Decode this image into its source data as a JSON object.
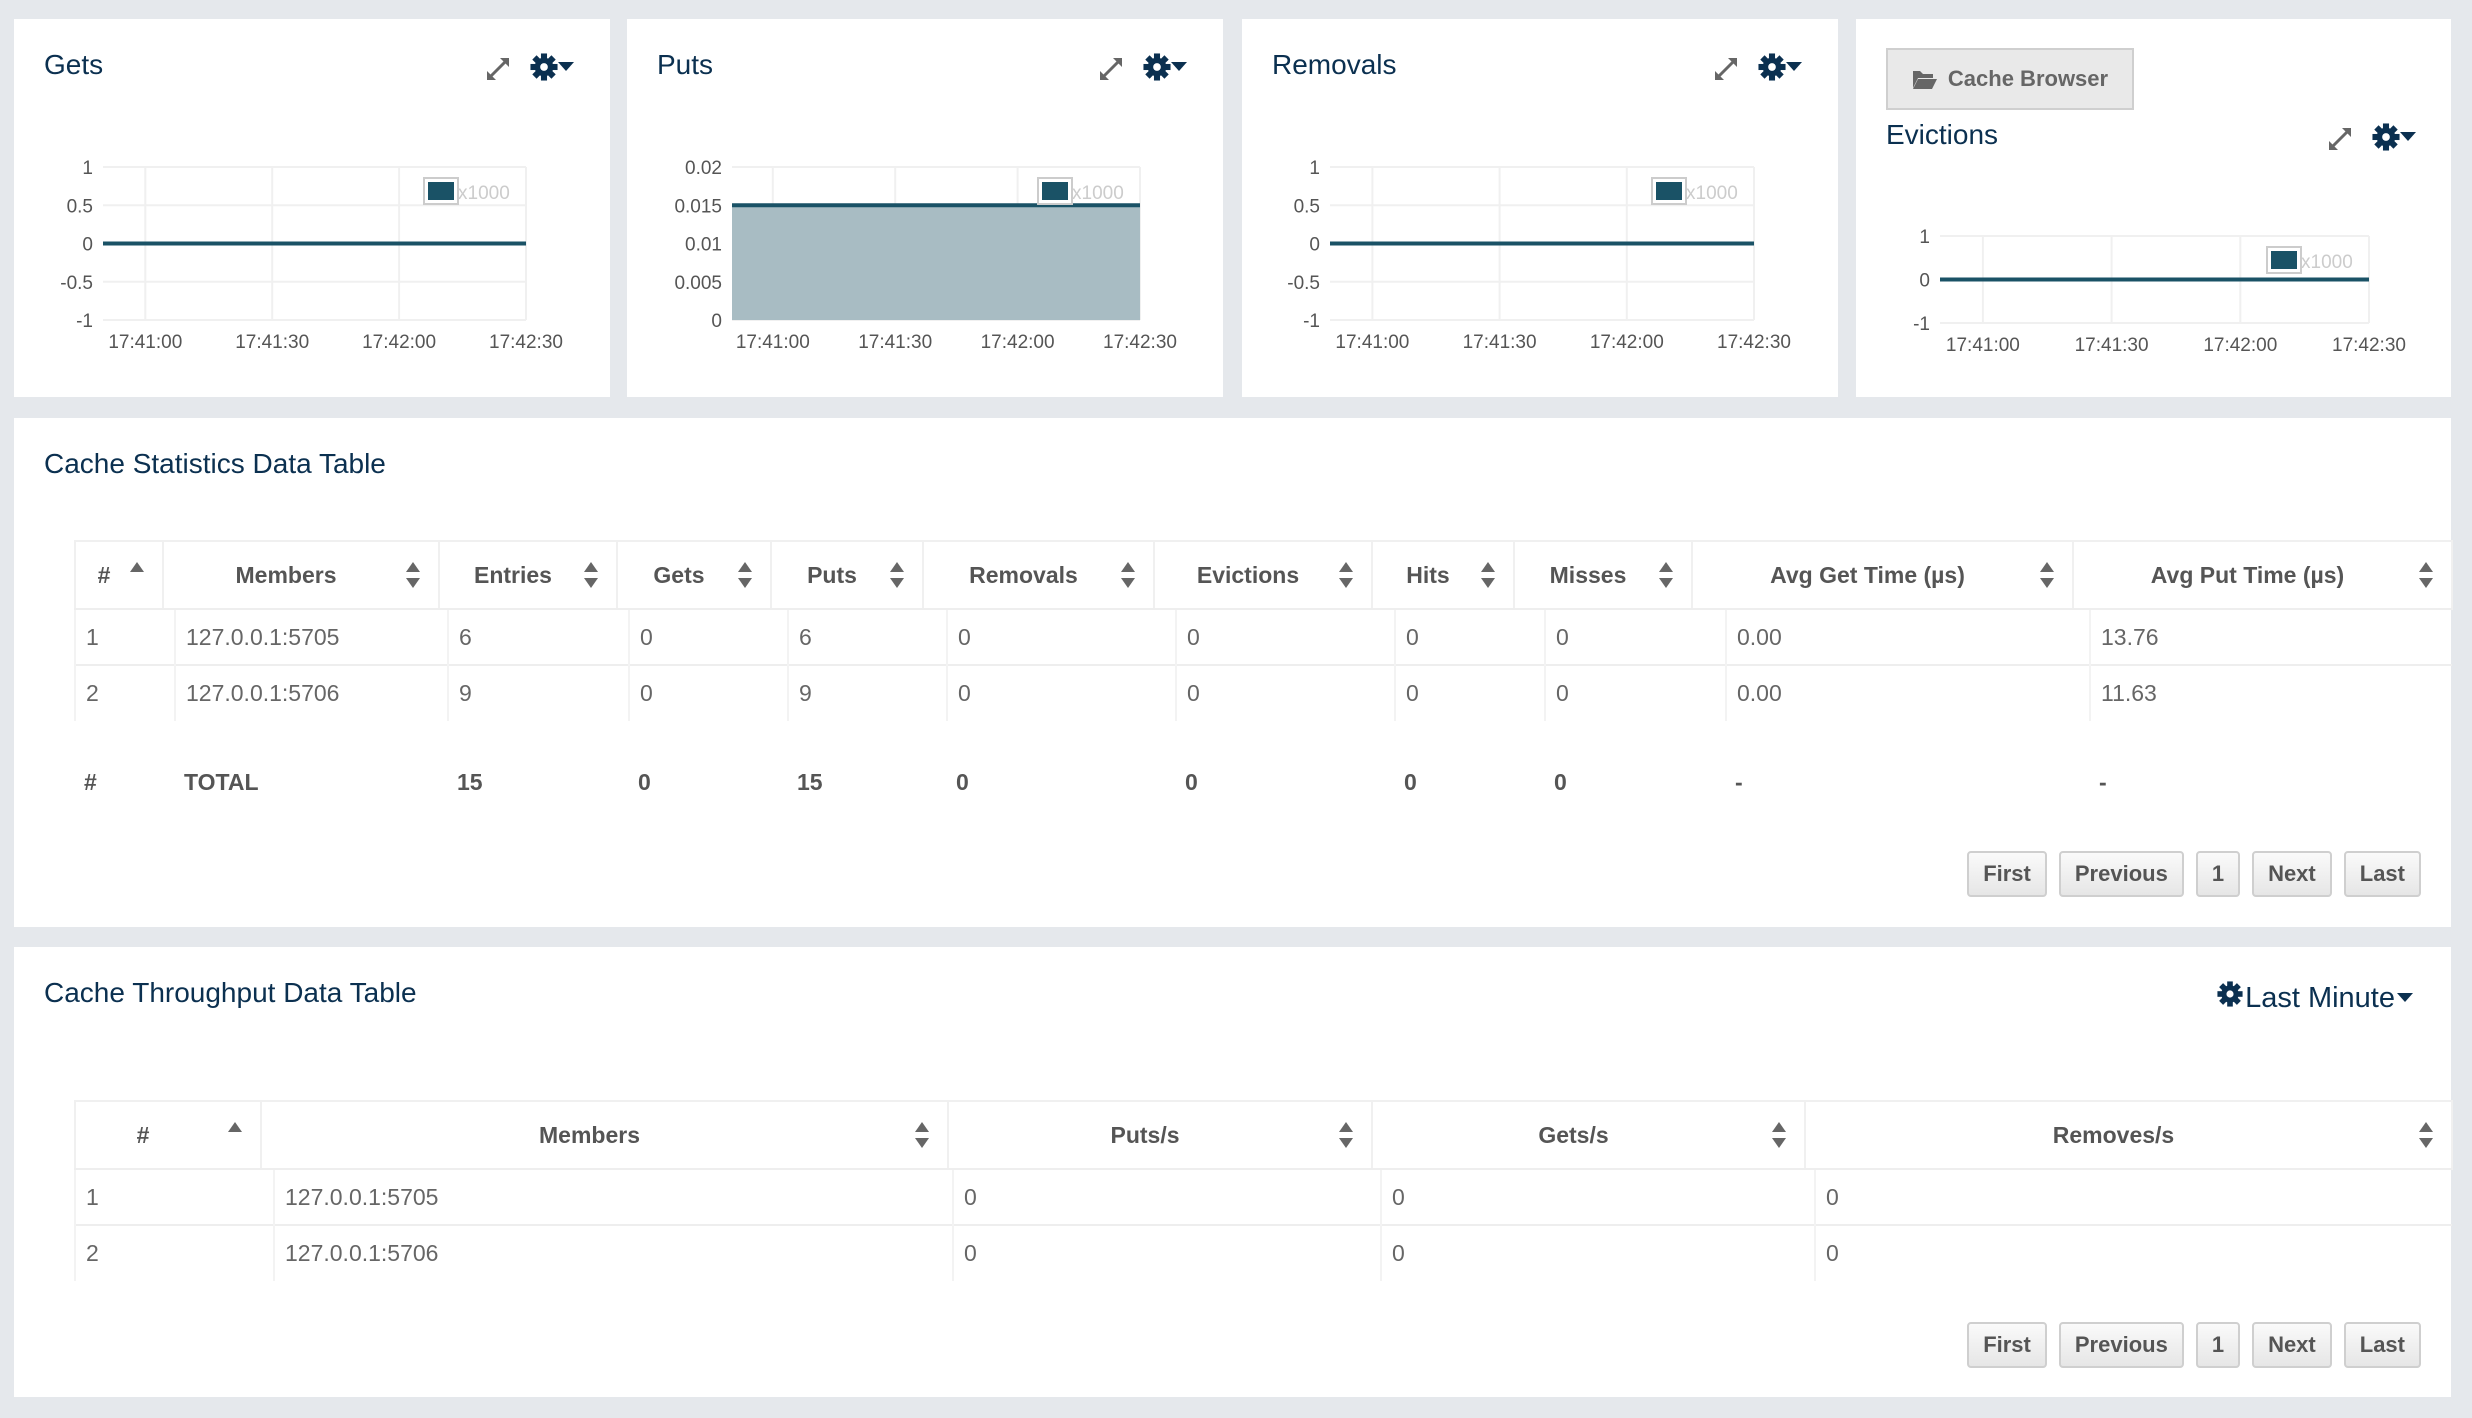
{
  "colors": {
    "brand": "#0b3050",
    "series": "#1a5266",
    "area_fill": "#a3b8c0",
    "grid": "#f0f0f0",
    "legend_text": "#cccccc",
    "axis_text": "#555555"
  },
  "charts": [
    {
      "id": "gets",
      "title": "Gets",
      "chart_data": {
        "type": "line",
        "title": "Gets",
        "x": [
          "17:41:00",
          "17:41:30",
          "17:42:00",
          "17:42:30"
        ],
        "yticks": [
          "1",
          "0.5",
          "0",
          "-0.5",
          "-1"
        ],
        "ylim": [
          -1,
          1
        ],
        "series": [
          {
            "name": "x1000",
            "values": [
              0,
              0,
              0,
              0
            ]
          }
        ],
        "fill": false,
        "legend": "top-right",
        "grid": true
      }
    },
    {
      "id": "puts",
      "title": "Puts",
      "chart_data": {
        "type": "area",
        "title": "Puts",
        "x": [
          "17:41:00",
          "17:41:30",
          "17:42:00",
          "17:42:30"
        ],
        "yticks": [
          "0.02",
          "0.015",
          "0.01",
          "0.005",
          "0"
        ],
        "ylim": [
          0,
          0.02
        ],
        "series": [
          {
            "name": "x1000",
            "values": [
              0.015,
              0.015,
              0.015,
              0.015
            ]
          }
        ],
        "fill": true,
        "legend": "top-right",
        "grid": true
      }
    },
    {
      "id": "removals",
      "title": "Removals",
      "chart_data": {
        "type": "line",
        "title": "Removals",
        "x": [
          "17:41:00",
          "17:41:30",
          "17:42:00",
          "17:42:30"
        ],
        "yticks": [
          "1",
          "0.5",
          "0",
          "-0.5",
          "-1"
        ],
        "ylim": [
          -1,
          1
        ],
        "series": [
          {
            "name": "x1000",
            "values": [
              0,
              0,
              0,
              0
            ]
          }
        ],
        "fill": false,
        "legend": "top-right",
        "grid": true
      }
    },
    {
      "id": "evictions",
      "title": "Evictions",
      "chart_data": {
        "type": "line",
        "title": "Evictions",
        "x": [
          "17:41:00",
          "17:41:30",
          "17:42:00",
          "17:42:30"
        ],
        "yticks": [
          "1",
          "0",
          "-1"
        ],
        "ylim": [
          -1,
          1
        ],
        "series": [
          {
            "name": "x1000",
            "values": [
              0,
              0,
              0,
              0
            ]
          }
        ],
        "fill": false,
        "legend": "top-right",
        "grid": true
      }
    }
  ],
  "cache_browser": {
    "label": "Cache Browser",
    "icon": "folder-open-icon"
  },
  "stats_table": {
    "title": "Cache Statistics Data Table",
    "columns": [
      "#",
      "Members",
      "Entries",
      "Gets",
      "Puts",
      "Removals",
      "Evictions",
      "Hits",
      "Misses",
      "Avg Get Time (µs)",
      "Avg Put Time (µs)"
    ],
    "rows": [
      [
        "1",
        "127.0.0.1:5705",
        "6",
        "0",
        "6",
        "0",
        "0",
        "0",
        "0",
        "0.00",
        "13.76"
      ],
      [
        "2",
        "127.0.0.1:5706",
        "9",
        "0",
        "9",
        "0",
        "0",
        "0",
        "0",
        "0.00",
        "11.63"
      ]
    ],
    "total": [
      "#",
      "TOTAL",
      "15",
      "0",
      "15",
      "0",
      "0",
      "0",
      "0",
      "-",
      "-"
    ],
    "pager": {
      "first": "First",
      "previous": "Previous",
      "page": "1",
      "next": "Next",
      "last": "Last"
    }
  },
  "throughput_table": {
    "title": "Cache Throughput Data Table",
    "interval_label": "Last Minute",
    "columns": [
      "#",
      "Members",
      "Puts/s",
      "Gets/s",
      "Removes/s"
    ],
    "rows": [
      [
        "1",
        "127.0.0.1:5705",
        "0",
        "0",
        "0"
      ],
      [
        "2",
        "127.0.0.1:5706",
        "0",
        "0",
        "0"
      ]
    ],
    "pager": {
      "first": "First",
      "previous": "Previous",
      "page": "1",
      "next": "Next",
      "last": "Last"
    }
  }
}
